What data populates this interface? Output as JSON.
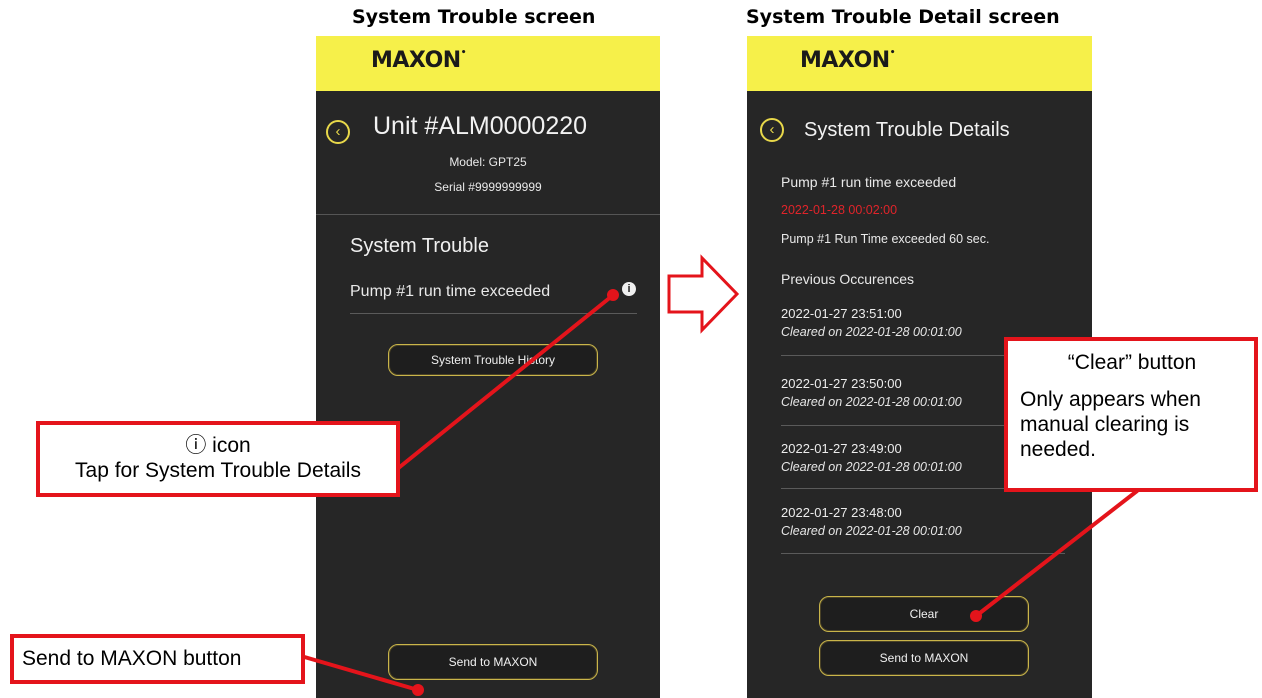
{
  "captions": {
    "left": "System Trouble screen",
    "right": "System Trouble Detail screen"
  },
  "left_screen": {
    "logo": "MAXON",
    "unit_title": "Unit #ALM0000220",
    "model": "Model: GPT25",
    "serial": "Serial #9999999999",
    "section_title": "System Trouble",
    "trouble_item": "Pump #1 run time exceeded",
    "history_button": "System Trouble History",
    "send_button": "Send to MAXON"
  },
  "right_screen": {
    "logo": "MAXON",
    "title": "System Trouble Details",
    "trouble_name": "Pump #1 run time exceeded",
    "trouble_time": "2022-01-28 00:02:00",
    "trouble_desc": "Pump #1 Run Time exceeded 60 sec.",
    "previous_label": "Previous Occurences",
    "occurrences": [
      {
        "date": "2022-01-27 23:51:00",
        "cleared": "Cleared on 2022-01-28 00:01:00"
      },
      {
        "date": "2022-01-27 23:50:00",
        "cleared": "Cleared on 2022-01-28 00:01:00"
      },
      {
        "date": "2022-01-27 23:49:00",
        "cleared": "Cleared on 2022-01-28 00:01:00"
      },
      {
        "date": "2022-01-27 23:48:00",
        "cleared": "Cleared on 2022-01-28 00:01:00"
      }
    ],
    "clear_button": "Clear",
    "send_button": "Send to MAXON"
  },
  "callouts": {
    "info_icon_glyph": "ⓘ",
    "info_icon_word": "icon",
    "info_icon_desc": "Tap for System Trouble Details",
    "send_label": "Send to MAXON button",
    "clear_title": "“Clear” button",
    "clear_desc": "Only appears when manual clearing is needed."
  },
  "colors": {
    "brand_yellow": "#f6f04a",
    "screen_bg": "#262626",
    "accent_gold": "#e8d84a",
    "alert_red": "#e0242a",
    "callout_red": "#e4141b"
  },
  "icons": {
    "back": "chevron-left-circle-icon",
    "info": "info-circle-icon",
    "arrow": "right-arrow-outline-icon"
  }
}
